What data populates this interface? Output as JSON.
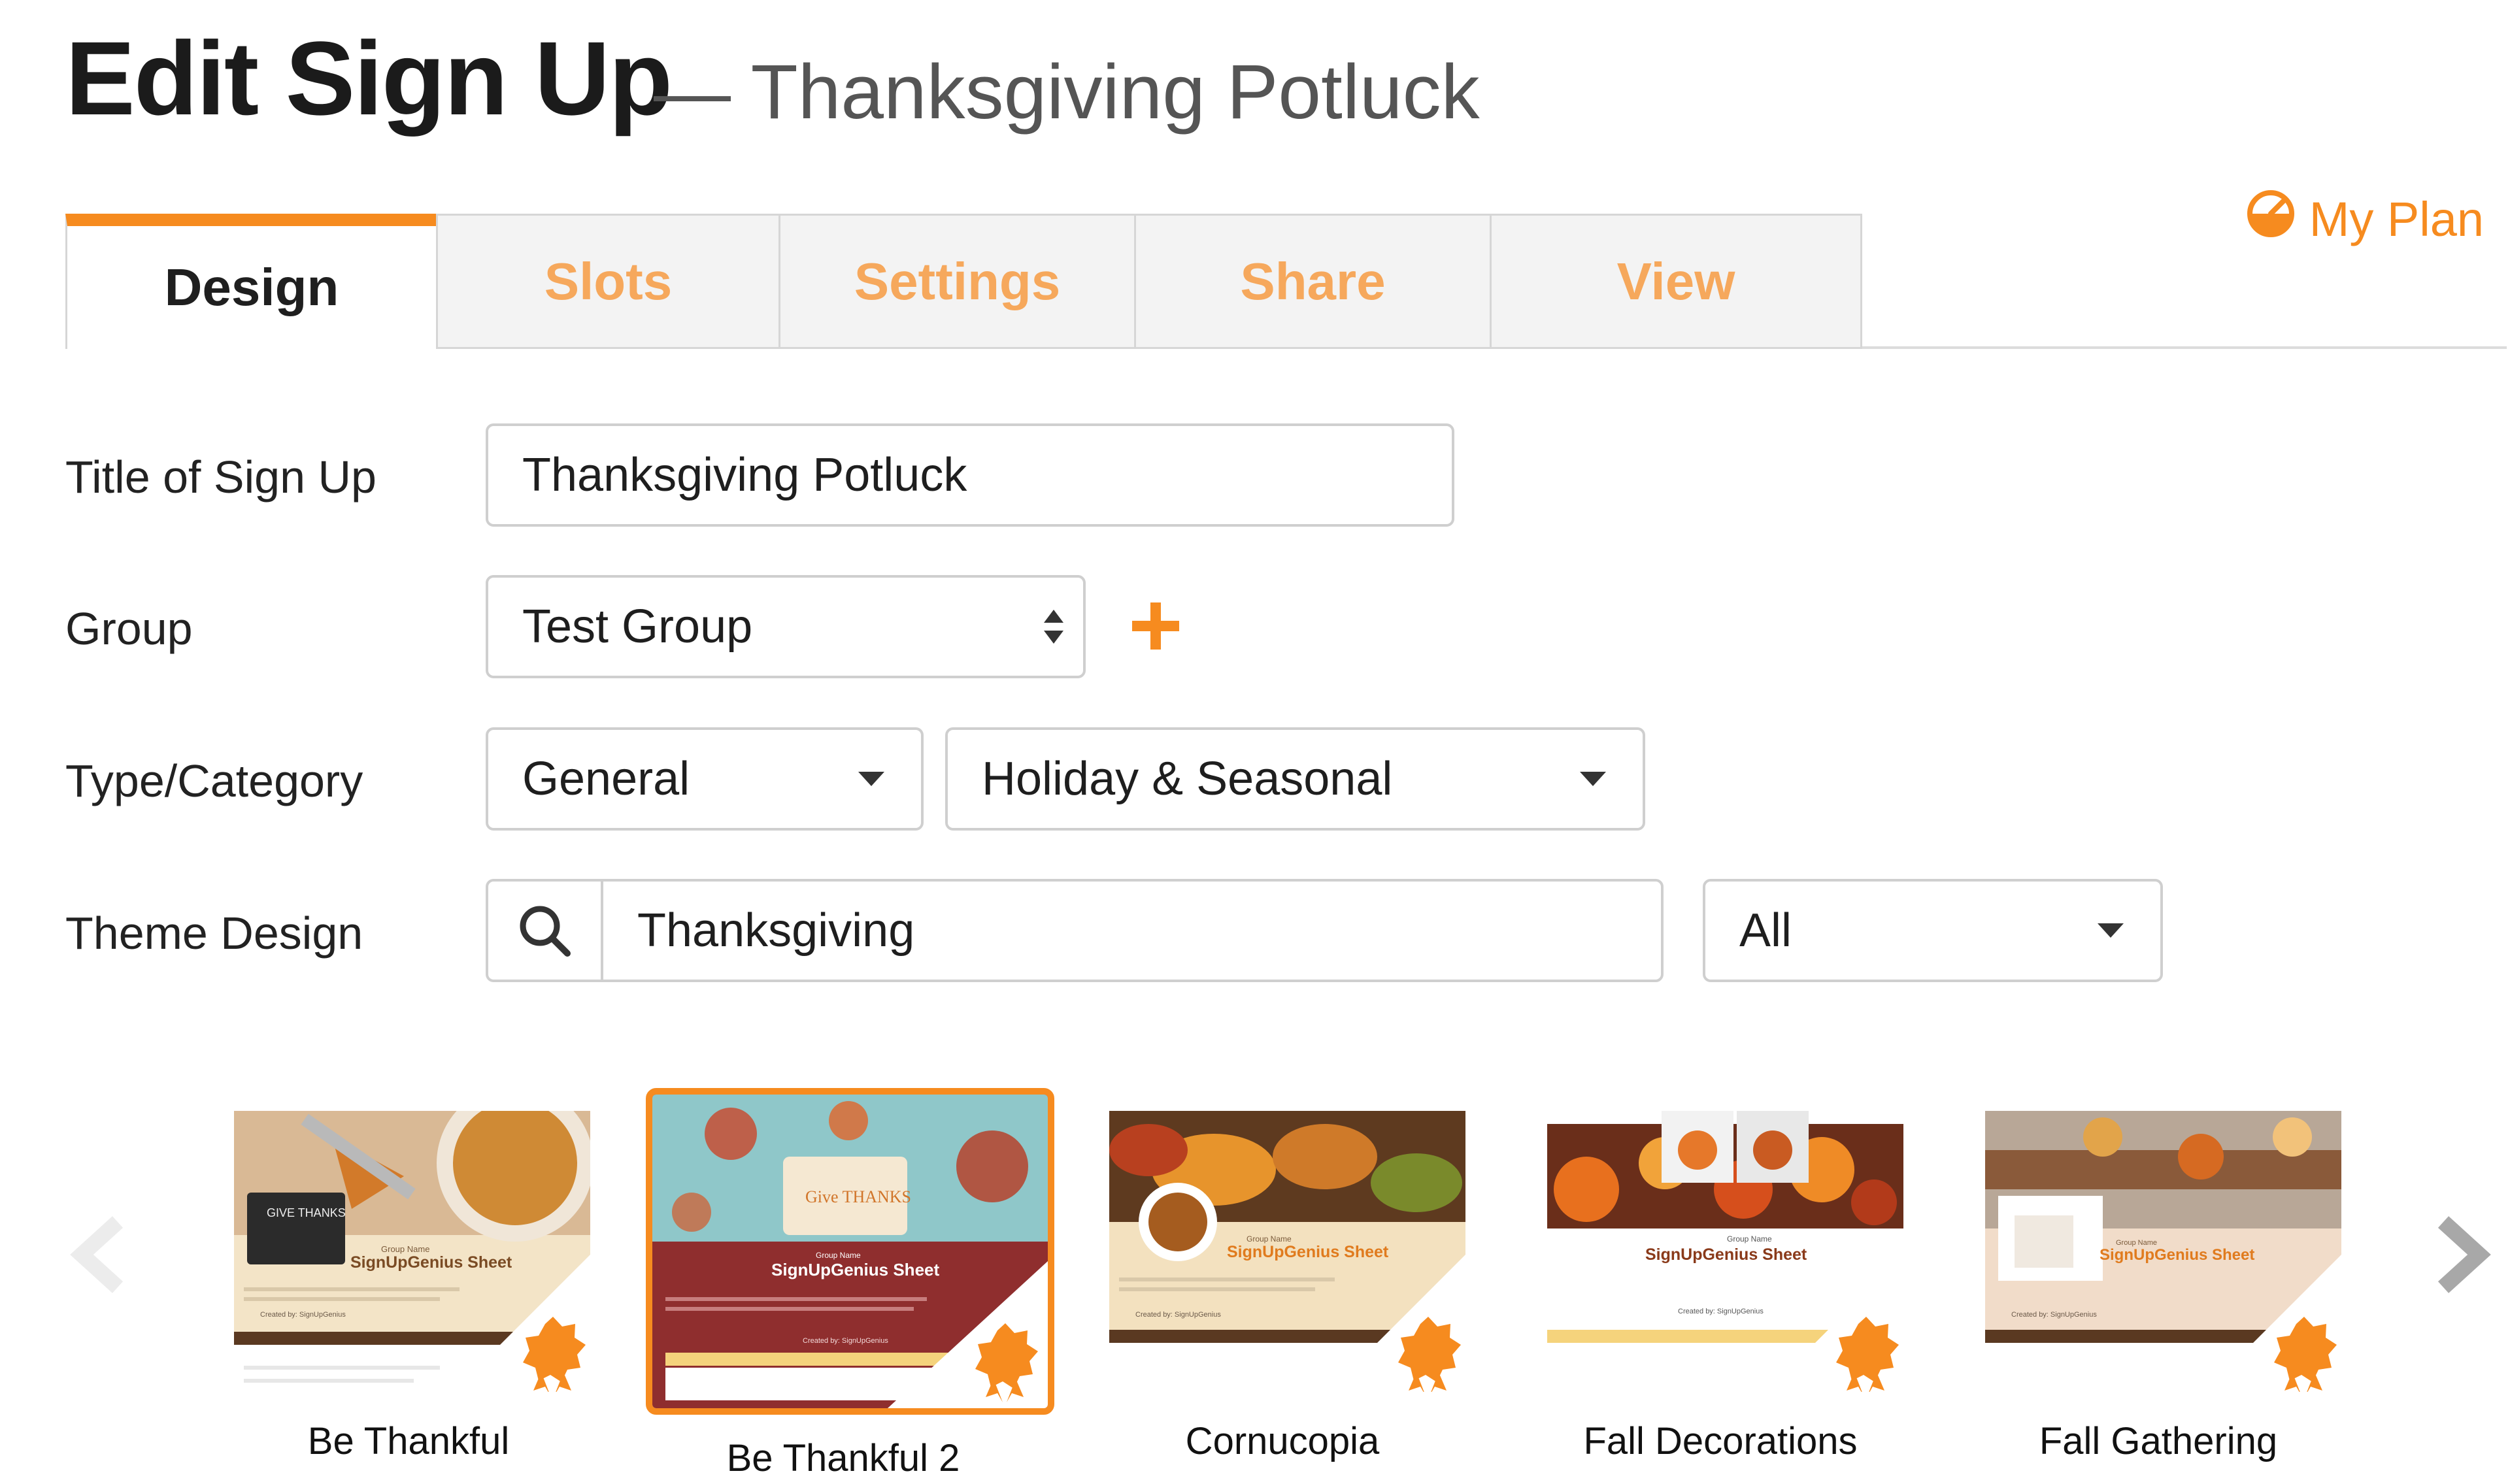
{
  "header": {
    "title": "Edit Sign Up",
    "subtitle": "— Thanksgiving Potluck"
  },
  "tabs": [
    {
      "label": "Design",
      "active": true
    },
    {
      "label": "Slots",
      "active": false
    },
    {
      "label": "Settings",
      "active": false
    },
    {
      "label": "Share",
      "active": false
    },
    {
      "label": "View",
      "active": false
    }
  ],
  "my_plan": {
    "label": "My Plan",
    "icon": "gauge-icon"
  },
  "form": {
    "title_label": "Title of Sign Up",
    "title_value": "Thanksgiving Potluck",
    "group_label": "Group",
    "group_value": "Test Group",
    "add_group_icon": "plus-icon",
    "type_label": "Type/Category",
    "type_value": "General",
    "category_value": "Holiday & Seasonal",
    "theme_label": "Theme Design",
    "theme_search_value": "Thanksgiving",
    "theme_filter_value": "All"
  },
  "themes": [
    {
      "name": "Be Thankful",
      "selected": false
    },
    {
      "name": "Be Thankful 2",
      "selected": true
    },
    {
      "name": "Cornucopia",
      "selected": false
    },
    {
      "name": "Fall Decorations",
      "selected": false
    },
    {
      "name": "Fall Gathering",
      "selected": false
    }
  ],
  "thumbnail_text": {
    "group_name": "Group Name",
    "sheet_title": "SignUpGenius Sheet",
    "created_by": "Created by: SignUpGenius",
    "be_thankful_badge": "GIVE THANKS",
    "be_thankful_2_badge": "Give THANKS"
  },
  "colors": {
    "accent": "#f68b1f",
    "tab_inactive_text": "#f6a85c",
    "text": "#222222",
    "border": "#cfcfcf"
  }
}
